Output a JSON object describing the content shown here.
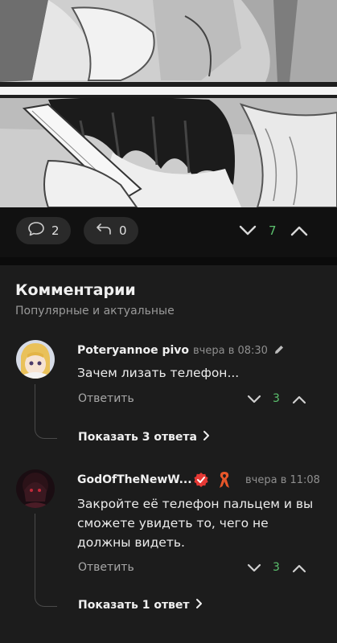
{
  "post": {
    "comments_count": "2",
    "reposts_count": "0",
    "rating": "7"
  },
  "comments_section": {
    "title": "Комментарии",
    "subtitle": "Популярные и актуальные"
  },
  "comments": [
    {
      "author": "Poteryannoe pivo",
      "time": "вчера в 08:30",
      "text": "Зачем лизать телефон...",
      "reply_label": "Ответить",
      "rating": "3",
      "show_replies": "Показать 3 ответа"
    },
    {
      "author": "GodOfTheNewW...",
      "time": "вчера в 11:08",
      "text": "Закройте её телефон пальцем и вы сможете увидеть то, чего не должны видеть.",
      "reply_label": "Ответить",
      "rating": "3",
      "show_replies": "Показать 1 ответ"
    }
  ],
  "colors": {
    "background": "#1c1c1c",
    "rating_green": "#5bc06d",
    "verified_red": "#e53935",
    "ribbon_orange": "#e8572a"
  },
  "icons": [
    "comment-icon",
    "repost-icon",
    "downvote-icon",
    "upvote-icon",
    "edit-pencil-icon",
    "verified-badge-icon",
    "ribbon-icon",
    "chevron-right-icon"
  ]
}
